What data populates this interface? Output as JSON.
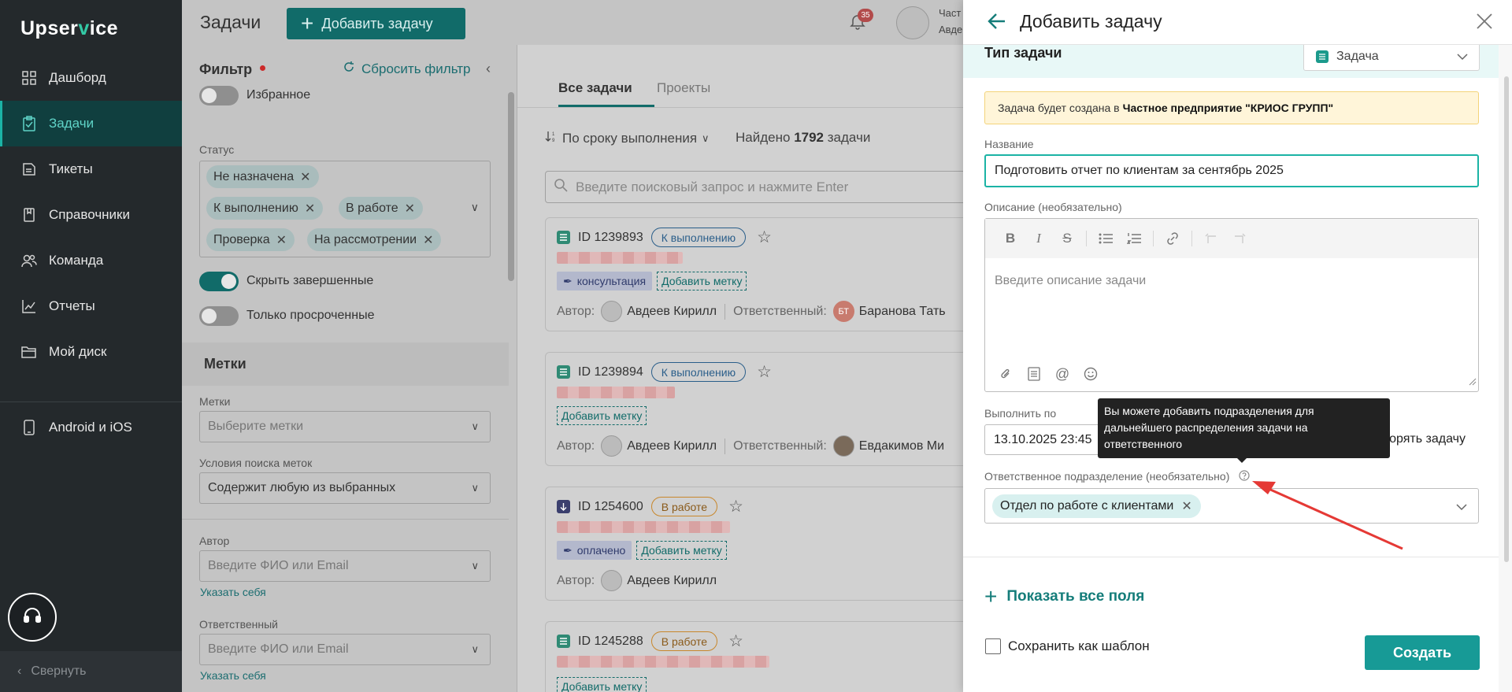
{
  "sidebar": {
    "logo_main": "Upser",
    "logo_v": "v",
    "logo_end": "ice",
    "items": [
      {
        "label": "Дашборд",
        "icon": "dashboard-icon"
      },
      {
        "label": "Задачи",
        "icon": "tasks-icon",
        "active": true
      },
      {
        "label": "Тикеты",
        "icon": "ticket-icon"
      },
      {
        "label": "Справочники",
        "icon": "book-icon"
      },
      {
        "label": "Команда",
        "icon": "team-icon"
      },
      {
        "label": "Отчеты",
        "icon": "chart-icon"
      },
      {
        "label": "Мой диск",
        "icon": "folder-icon"
      },
      {
        "label": "Android и iOS",
        "icon": "phone-icon"
      }
    ],
    "collapse_label": "Свернуть"
  },
  "header": {
    "title": "Задачи",
    "add_task_label": "Добавить задачу",
    "notifications_count": "35",
    "user_line1": "Част",
    "user_line2": "Авде"
  },
  "filter": {
    "title": "Фильтр",
    "reset_label": "Сбросить фильтр",
    "favorites_label": "Избранное",
    "status_label": "Статус",
    "status_chips": [
      "Не назначена",
      "К выполнению",
      "В работе",
      "Проверка",
      "На рассмотрении"
    ],
    "hide_completed_label": "Скрыть завершенные",
    "only_overdue_label": "Только просроченные",
    "tags_section": "Метки",
    "tags_label": "Метки",
    "tags_placeholder": "Выберите метки",
    "tag_condition_label": "Условия поиска меток",
    "tag_condition_value": "Содержит любую из выбранных",
    "author_label": "Автор",
    "author_placeholder": "Введите ФИО или Email",
    "author_self": "Указать себя",
    "assignee_label": "Ответственный",
    "assignee_placeholder": "Введите ФИО или Email",
    "assignee_self": "Указать себя"
  },
  "list": {
    "tabs": [
      "Все задачи",
      "Проекты"
    ],
    "sort_label": "По сроку выполнения",
    "found_prefix": "Найдено",
    "found_count": "1792",
    "found_suffix": "задачи",
    "search_placeholder": "Введите поисковый запрос и нажмите Enter",
    "author_prefix": "Автор:",
    "assignee_prefix": "Ответственный:",
    "add_tag_label": "Добавить метку",
    "cards": [
      {
        "id": "ID 1239893",
        "status": "К выполнению",
        "tag": "консультация",
        "author": "Авдеев Кирилл",
        "assignee": "Баранова Тать",
        "assignee_initials": "БТ"
      },
      {
        "id": "ID 1239894",
        "status": "К выполнению",
        "tag": "",
        "author": "Авдеев Кирилл",
        "assignee": "Евдакимов Ми",
        "assignee_initials": ""
      },
      {
        "id": "ID 1254600",
        "status": "В работе",
        "tag": "оплачено",
        "author": "Авдеев Кирилл",
        "assignee": "",
        "assignee_initials": ""
      },
      {
        "id": "ID 1245288",
        "status": "В работе",
        "tag": "",
        "author": "",
        "assignee": "",
        "assignee_initials": ""
      }
    ]
  },
  "modal": {
    "title": "Добавить задачу",
    "type_label": "Тип задачи",
    "type_value": "Задача",
    "notice_prefix": "Задача будет создана в",
    "notice_org": "Частное предприятие \"КРИОС ГРУПП\"",
    "name_label": "Название",
    "name_value": "Подготовить отчет по клиентам за сентябрь 2025",
    "description_label": "Описание (необязательно)",
    "description_placeholder": "Введите описание задачи",
    "due_label": "Выполнить по",
    "due_value": "13.10.2025 23:45",
    "repeat_label": "торять задачу",
    "tooltip": "Вы можете добавить подразделения для дальнейшего распределения задачи на ответственного",
    "dept_label": "Ответственное подразделение (необязательно)",
    "dept_chip": "Отдел по работе с клиентами",
    "show_all_label": "Показать все поля",
    "save_template_label": "Сохранить как шаблон",
    "create_label": "Создать"
  },
  "colors": {
    "accent": "#1bb3a5",
    "primary_button": "#179a96",
    "sidebar_bg": "#24292c",
    "annotation_arrow": "#e53935",
    "notice_bg": "#fff5d9"
  }
}
